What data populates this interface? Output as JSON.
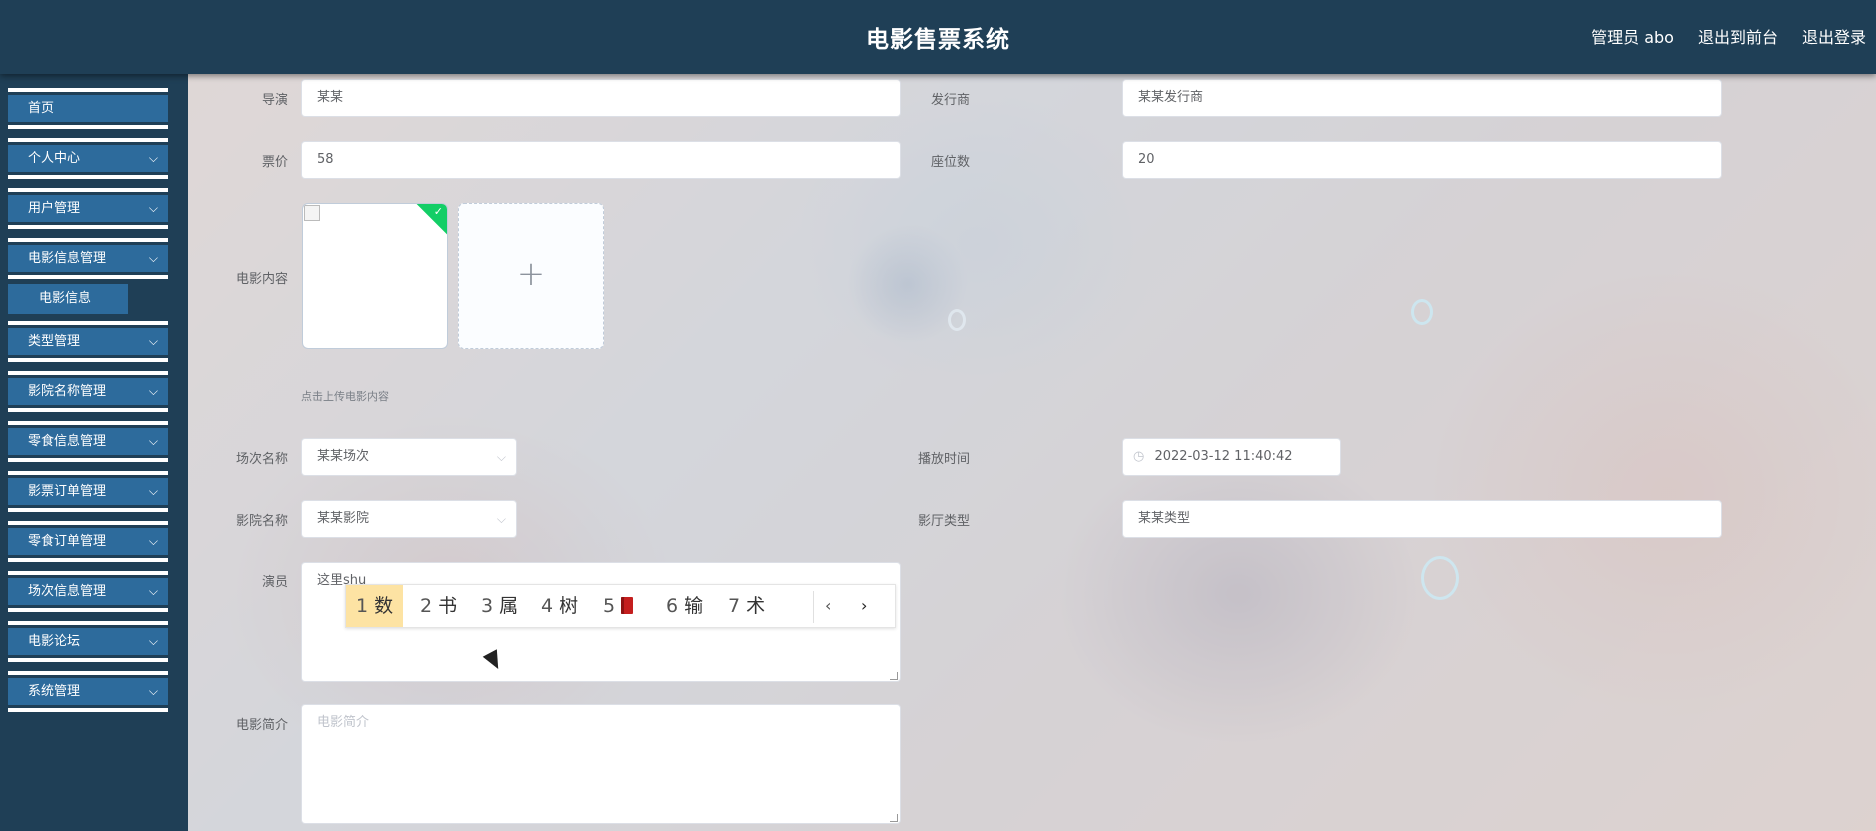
{
  "header": {
    "title": "电影售票系统",
    "admin": "管理员 abo",
    "to_front": "退出到前台",
    "logout": "退出登录"
  },
  "sidebar": {
    "items": [
      {
        "label": "首页"
      },
      {
        "label": "个人中心"
      },
      {
        "label": "用户管理"
      },
      {
        "label": "电影信息管理"
      },
      {
        "label": "类型管理"
      },
      {
        "label": "影院名称管理"
      },
      {
        "label": "零食信息管理"
      },
      {
        "label": "影票订单管理"
      },
      {
        "label": "零食订单管理"
      },
      {
        "label": "场次信息管理"
      },
      {
        "label": "电影论坛"
      },
      {
        "label": "系统管理"
      }
    ],
    "submenu": {
      "label": "电影信息"
    },
    "chevron": "⌵"
  },
  "form": {
    "director": {
      "label": "导演",
      "value": "某某"
    },
    "publisher": {
      "label": "发行商",
      "value": "某某发行商"
    },
    "price": {
      "label": "票价",
      "value": "58"
    },
    "seats": {
      "label": "座位数",
      "value": "20"
    },
    "content": {
      "label": "电影内容",
      "tip": "点击上传电影内容",
      "add_icon": "+",
      "check_icon": "✓"
    },
    "session": {
      "label": "场次名称",
      "value": "某某场次"
    },
    "play_time": {
      "label": "播放时间",
      "value": "2022-03-12 11:40:42",
      "icon": "◷"
    },
    "cinema": {
      "label": "影院名称",
      "value": "某某影院"
    },
    "hall_type": {
      "label": "影厅类型",
      "value": "某某类型"
    },
    "actors": {
      "label": "演员",
      "value": "这里shu"
    },
    "intro": {
      "label": "电影简介",
      "placeholder": "电影简介"
    },
    "arrow": "⌵"
  },
  "ime": {
    "candidates": [
      {
        "num": "1",
        "text": "数"
      },
      {
        "num": "2",
        "text": "书"
      },
      {
        "num": "3",
        "text": "属"
      },
      {
        "num": "4",
        "text": "树"
      },
      {
        "num": "5",
        "text": ""
      },
      {
        "num": "6",
        "text": "输"
      },
      {
        "num": "7",
        "text": "术"
      }
    ],
    "prev": "‹",
    "next": "›"
  },
  "colors": {
    "header_bg": "#1f3f56",
    "menu_bg": "#2d6b9c",
    "ime_highlight": "#fde3a3",
    "upload_success": "#13ce66"
  }
}
